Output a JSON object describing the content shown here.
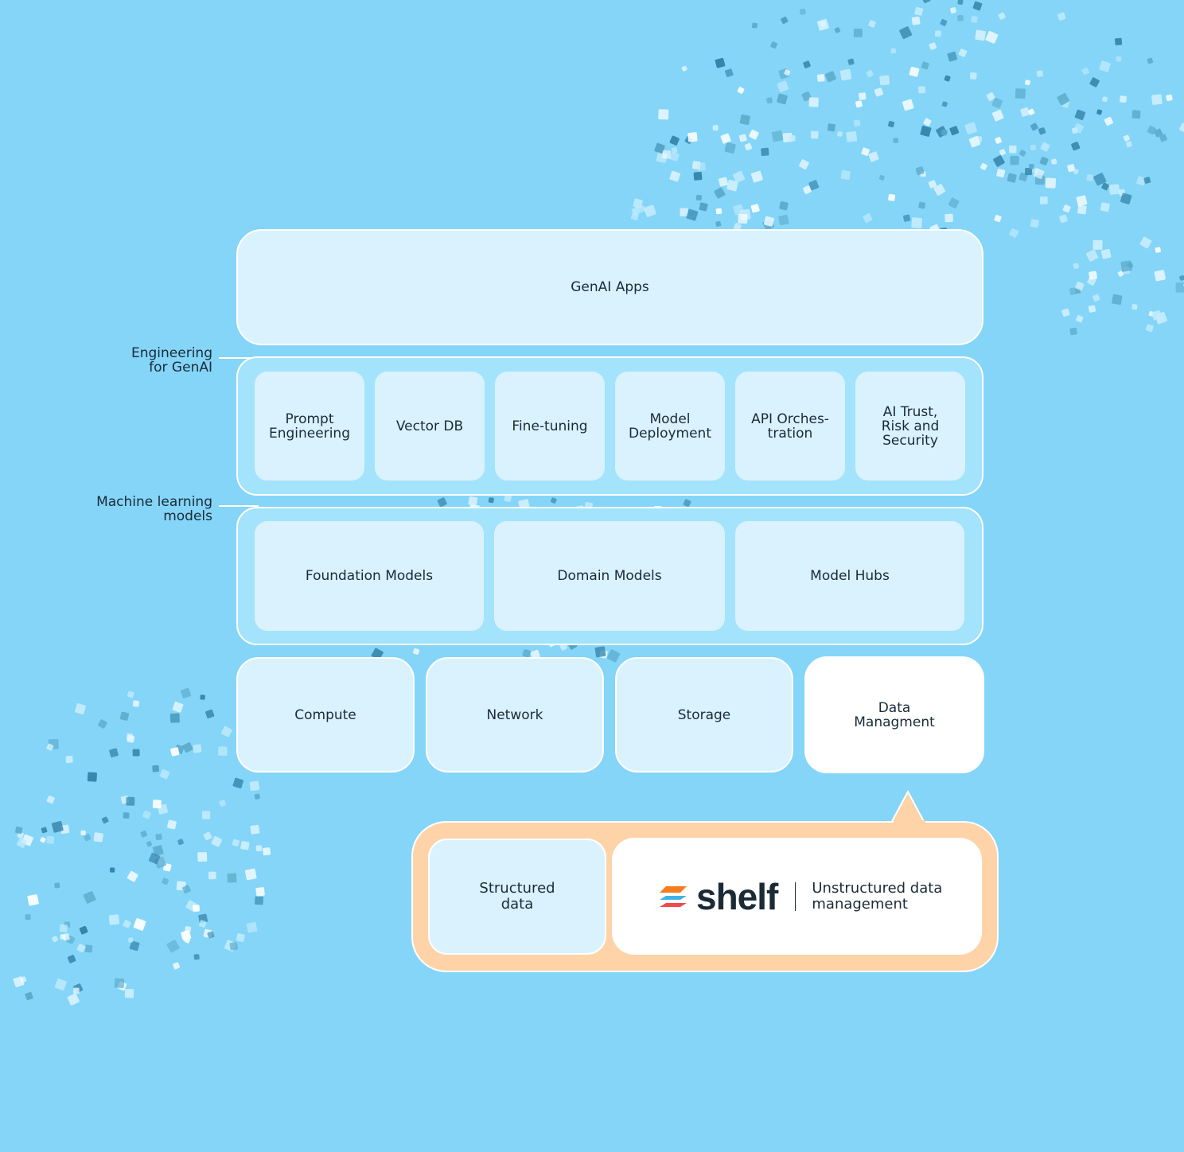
{
  "background_color": "#84d5f8",
  "top": {
    "label": "GenAI Apps"
  },
  "side_labels": {
    "engineering": "Engineering\nfor GenAI",
    "ml_models": "Machine learning\nmodels"
  },
  "engineering_row": [
    {
      "label": "Prompt\nEngineering"
    },
    {
      "label": "Vector DB"
    },
    {
      "label": "Fine-tuning"
    },
    {
      "label": "Model\nDeployment"
    },
    {
      "label": "API Orches-\ntration"
    },
    {
      "label": "AI Trust,\nRisk and\nSecurity"
    }
  ],
  "models_row": [
    {
      "label": "Foundation Models"
    },
    {
      "label": "Domain Models"
    },
    {
      "label": "Model Hubs"
    }
  ],
  "infra_row": [
    {
      "label": "Compute"
    },
    {
      "label": "Network"
    },
    {
      "label": "Storage"
    },
    {
      "label": "Data\nManagment",
      "highlight": true
    }
  ],
  "callout": {
    "structured": "Structured\ndata",
    "brand": "shelf",
    "unstructured": "Unstructured data\nmanagement",
    "border_color": "#fed3a8",
    "logo_colors": [
      "#f57c1f",
      "#3fb3ea",
      "#ef4b4b"
    ]
  }
}
